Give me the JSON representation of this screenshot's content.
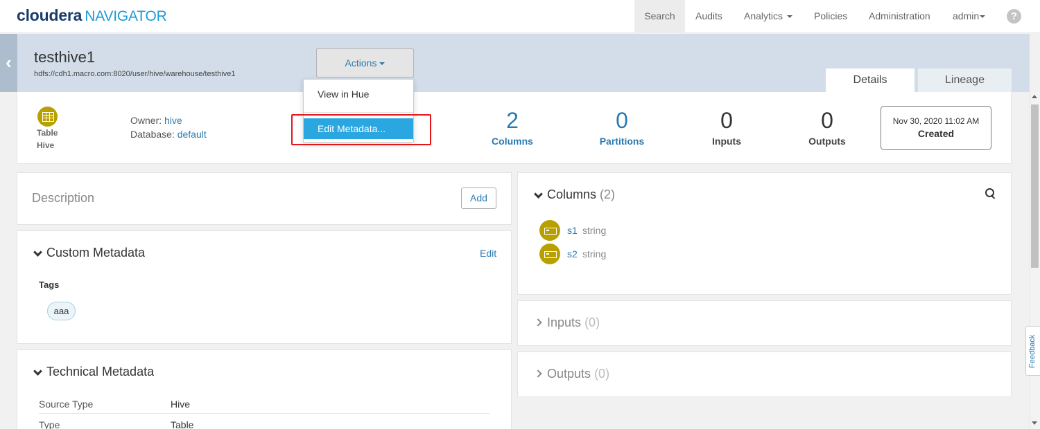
{
  "nav": {
    "brand": "cloudera",
    "product": "NAVIGATOR",
    "items": [
      "Search",
      "Audits",
      "Analytics",
      "Policies",
      "Administration",
      "admin"
    ],
    "help_icon": "question-mark-icon"
  },
  "entity": {
    "title": "testhive1",
    "path": "hdfs://cdh1.macro.com:8020/user/hive/warehouse/testhive1",
    "type_line1": "Table",
    "type_line2": "Hive",
    "owner_label": "Owner:",
    "owner": "hive",
    "db_label": "Database:",
    "database": "default"
  },
  "actions": {
    "label": "Actions",
    "menu": [
      "View in Hue",
      "Edit Metadata..."
    ]
  },
  "tabs": [
    "Details",
    "Lineage"
  ],
  "stats": [
    {
      "value": "2",
      "label": "Columns"
    },
    {
      "value": "0",
      "label": "Partitions"
    },
    {
      "value": "0",
      "label": "Inputs"
    },
    {
      "value": "0",
      "label": "Outputs"
    }
  ],
  "created": {
    "date": "Nov 30, 2020 11:02 AM",
    "label": "Created"
  },
  "description": {
    "title": "Description",
    "add_label": "Add"
  },
  "custom_metadata": {
    "title": "Custom Metadata",
    "edit_label": "Edit",
    "tags_label": "Tags",
    "tags": [
      "aaa"
    ]
  },
  "technical_metadata": {
    "title": "Technical Metadata",
    "rows": [
      {
        "key": "Source Type",
        "value": "Hive"
      },
      {
        "key": "Type",
        "value": "Table"
      }
    ]
  },
  "columns_panel": {
    "title": "Columns",
    "count": "(2)",
    "columns": [
      {
        "name": "s1",
        "type": "string"
      },
      {
        "name": "s2",
        "type": "string"
      }
    ]
  },
  "inputs_panel": {
    "title": "Inputs",
    "count": "(0)"
  },
  "outputs_panel": {
    "title": "Outputs",
    "count": "(0)"
  },
  "feedback_label": "Feedback",
  "colors": {
    "accent": "#2a7ab0",
    "highlight": "#2aa7e1",
    "entity_icon": "#b8a000",
    "header_band": "#d2dde9",
    "annotation_box": "#e8141b"
  }
}
